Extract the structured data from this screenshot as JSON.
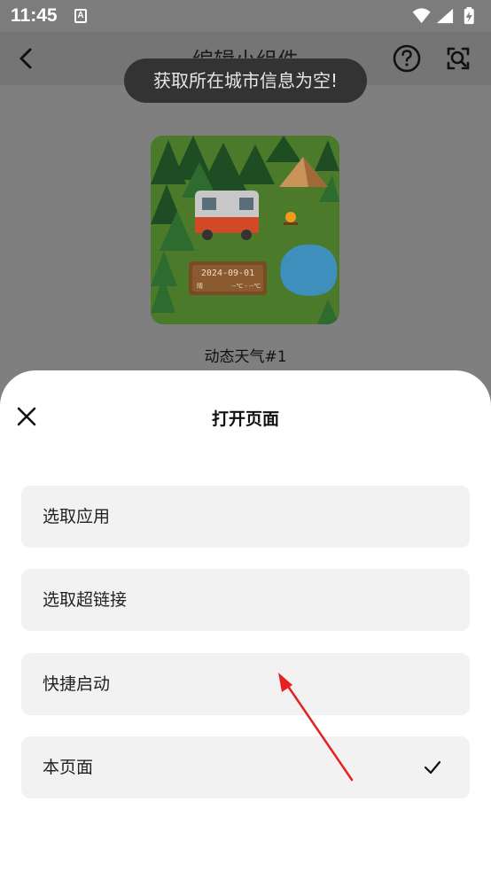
{
  "status_bar": {
    "time": "11:45",
    "notification_glyph": "A",
    "icons": [
      "wifi-icon",
      "signal-icon",
      "battery-charging-icon"
    ]
  },
  "header": {
    "title": "编辑小组件",
    "icons": [
      "back-icon",
      "help-icon",
      "search-icon"
    ]
  },
  "toast": {
    "message": "获取所在城市信息为空!"
  },
  "widget": {
    "date": "2024-09-01",
    "temp_left": "晴",
    "temp_range": "--℃ - --℃",
    "name": "动态天气#1"
  },
  "sheet": {
    "title": "打开页面",
    "close_icon": "close-icon",
    "options": [
      {
        "label": "选取应用",
        "selected": false
      },
      {
        "label": "选取超链接",
        "selected": false
      },
      {
        "label": "快捷启动",
        "selected": false
      },
      {
        "label": "本页面",
        "selected": true
      }
    ]
  },
  "colors": {
    "overlay": "#7f7f7f",
    "sheet_bg": "#ffffff",
    "option_bg": "#f2f2f2",
    "toast_bg": "#333333",
    "arrow": "#e52222"
  }
}
